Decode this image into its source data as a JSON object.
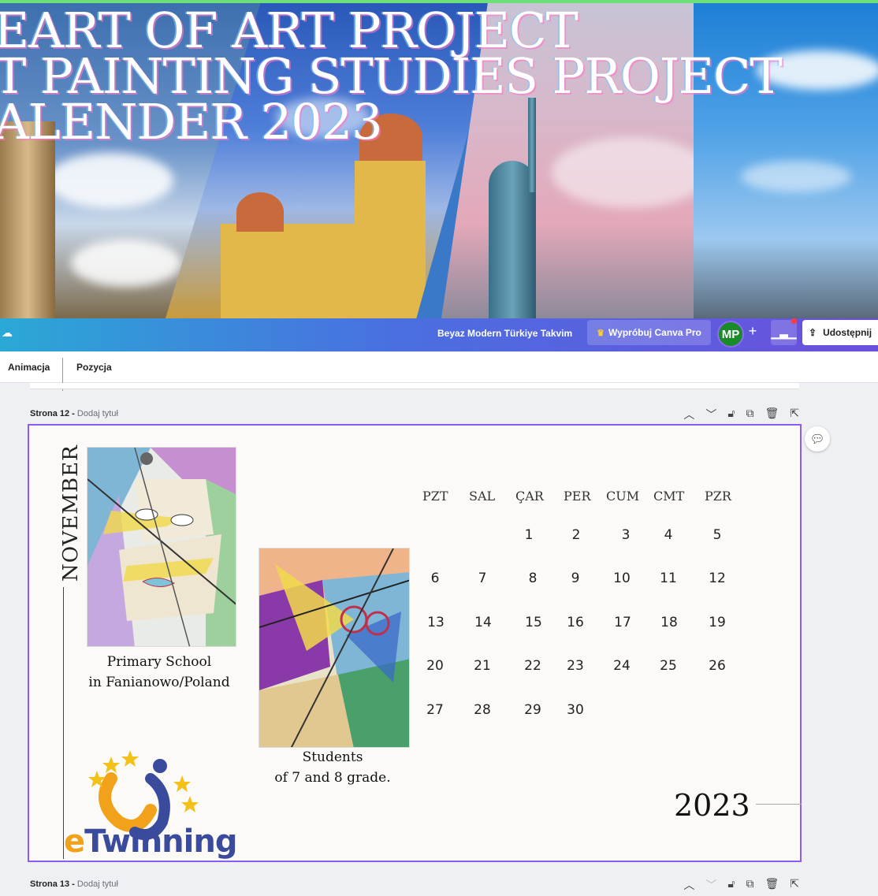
{
  "banner": {
    "title_lines": [
      "EART OF ART PROJECT",
      "T PAINTING STUDIES PROJECT",
      "ALENDER 2023"
    ]
  },
  "topbar": {
    "doc_title": "Beyaz Modern Türkiye Takvim",
    "try_pro_label": "Wypróbuj Canva Pro",
    "avatar_initials": "MP",
    "plus_label": "+",
    "share_label": "Udostępnij"
  },
  "subbar": {
    "tabs": [
      "Animacja",
      "Pozycja"
    ]
  },
  "pages": [
    {
      "label": "Strona 12 -",
      "add_title": "Dodaj tytuł"
    },
    {
      "label": "Strona 13 -",
      "add_title": "Dodaj tytuł"
    }
  ],
  "calendar": {
    "month": "NOVEMBER",
    "year": "2023",
    "weekdays": [
      "PZT",
      "SAL",
      "ÇAR",
      "PER",
      "CUM",
      "CMT",
      "PZR"
    ],
    "weeks": [
      [
        "",
        "",
        "1",
        "2",
        "3",
        "4",
        "5"
      ],
      [
        "6",
        "7",
        "8",
        "9",
        "10",
        "11",
        "12"
      ],
      [
        "13",
        "14",
        "15",
        "16",
        "17",
        "18",
        "19"
      ],
      [
        "20",
        "21",
        "22",
        "23",
        "24",
        "25",
        "26"
      ],
      [
        "27",
        "28",
        "29",
        "30",
        "",
        "",
        ""
      ]
    ]
  },
  "captions": {
    "art1_line1": "Primary School",
    "art1_line2": "in Fanianowo/Poland",
    "art2_line1": "Students",
    "art2_line2": "of 7 and 8 grade."
  },
  "logo": {
    "e": "e",
    "rest": "Twinning"
  },
  "colors": {
    "accent": "#8a5cf5",
    "avatar_bg": "#1a8a2a",
    "notification": "#ff3b3b"
  }
}
